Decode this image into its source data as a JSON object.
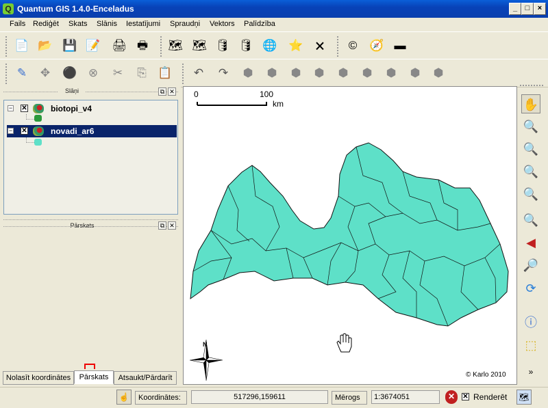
{
  "window": {
    "title": "Quantum GIS 1.4.0-Enceladus",
    "app_icon": "Q",
    "controls": [
      "_",
      "□",
      "×"
    ]
  },
  "menu": [
    "Fails",
    "Rediģēt",
    "Skats",
    "Slānis",
    "Iestatījumi",
    "Spraudņi",
    "Vektors",
    "Palīdzība"
  ],
  "toolbar1": [
    "📄",
    "📂",
    "💾",
    "📝",
    "🖨",
    "🖶",
    "🗺",
    "🗺",
    "🛢",
    "🛢",
    "🌐",
    "⭐",
    "🗙",
    "©",
    "🧭",
    "▬"
  ],
  "toolbar2": [
    "✎",
    "✥",
    "⚫",
    "⊗",
    "✂",
    "⎘",
    "📋",
    "↶",
    "↷",
    "⬢",
    "⬢",
    "⬢",
    "⬢",
    "⬢",
    "⬢",
    "⬢",
    "⬢",
    "⬢"
  ],
  "panels": {
    "layers_title": "Slāņi",
    "overview_title": "Pārskats"
  },
  "layers": [
    {
      "name": "biotopi_v4",
      "checked": "✕",
      "expanded": "−",
      "selected": false
    },
    {
      "name": "novadi_ar6",
      "checked": "✕",
      "expanded": "−",
      "selected": true
    }
  ],
  "tabs": [
    "Nolasīt koordinātes",
    "Pārskats",
    "Atsaukt/Pārdarīt"
  ],
  "map": {
    "scale_start": "0",
    "scale_end": "100",
    "scale_unit": "km",
    "north": "N",
    "copyright": "© Karlo 2010",
    "fill": "#5ee0c8"
  },
  "right_tools": [
    "✋",
    "🔍",
    "🔍",
    "🔍",
    "🔍",
    "🔍",
    "◀",
    "🔎",
    "⟳",
    "ⓘ",
    "⬚",
    "»"
  ],
  "status": {
    "coord_label": "Koordinātes:",
    "coord_value": "517296,159611",
    "scale_label": "Mērogs",
    "scale_value": "1:3674051",
    "render_label": "Renderēt",
    "stop": "✕",
    "render_check": "✕"
  }
}
